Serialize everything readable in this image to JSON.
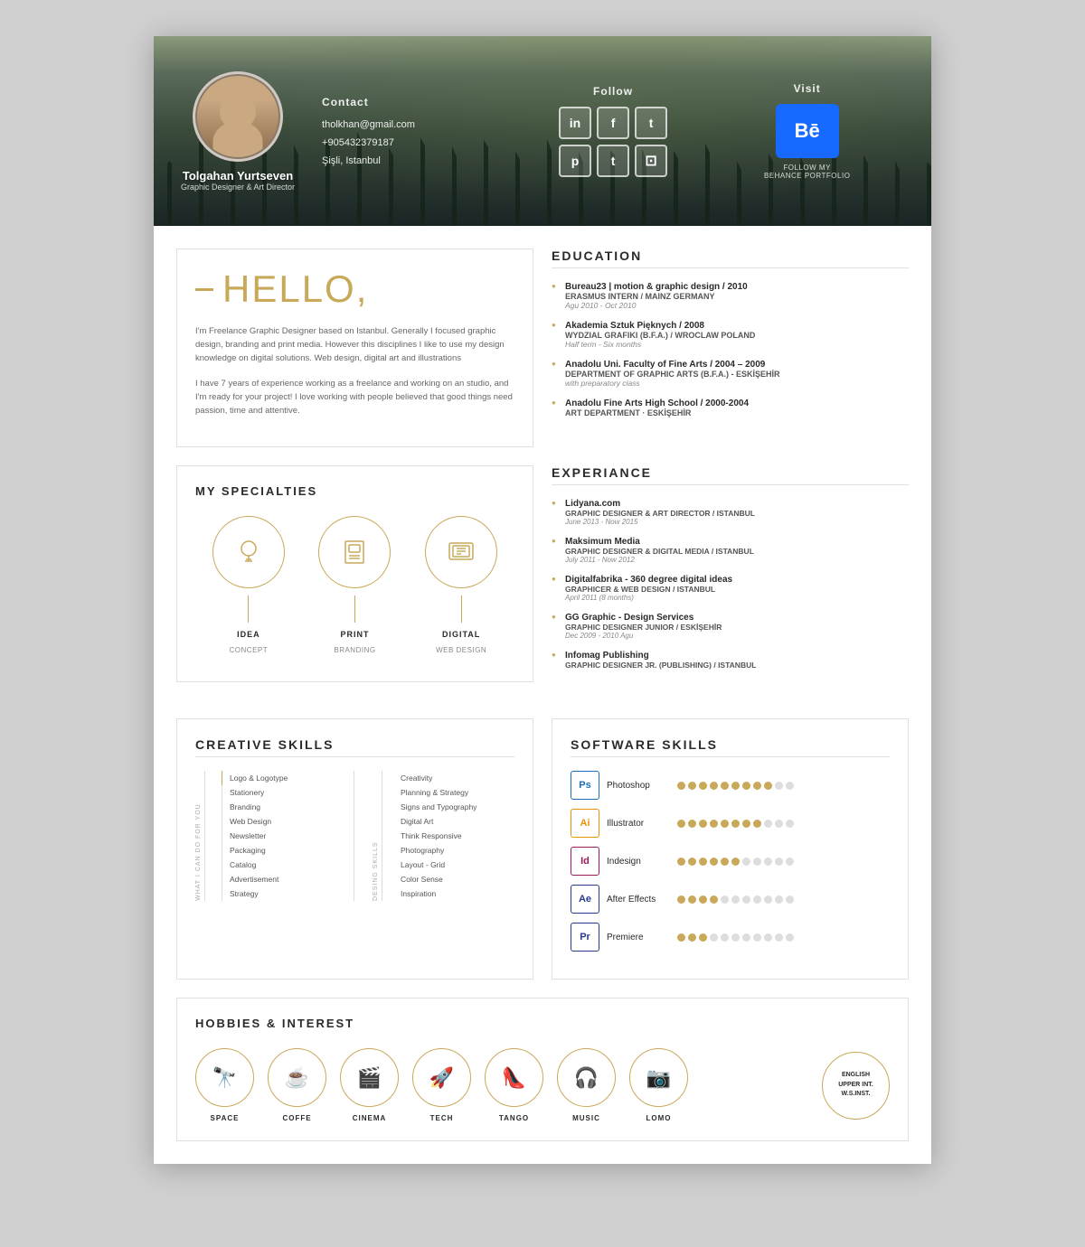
{
  "header": {
    "name": "Tolgahan Yurtseven",
    "title": "Graphic Designer & Art Director",
    "contact": {
      "label": "Contact",
      "email": "tholkhan@gmail.com",
      "phone": "+905432379187",
      "location": "Şişli, Istanbul"
    },
    "follow": {
      "label": "Follow",
      "networks": [
        "in",
        "f",
        "t",
        "p",
        "t",
        "📷"
      ]
    },
    "visit": {
      "label": "Visit",
      "behance_text": "Bē",
      "follow_text": "FOLLOW MY\nBEHANCE PORTFOLIO"
    }
  },
  "hello": {
    "heading": "HELLO,",
    "para1": "I'm Freelance Graphic Designer based on Istanbul. Generally I focused graphic design, branding and print media. However this disciplines I like to use my design knowledge on digital solutions. Web design, digital art and illustrations",
    "para2": "I have 7 years of experience working as a freelance and working on an studio, and I'm ready for your project! I love working with people believed that good things need passion, time and attentive."
  },
  "education": {
    "title": "EDUCATION",
    "items": [
      {
        "title": "Bureau23 | motion & graphic design / 2010",
        "sub": "ERASMUS INTERN / MAINZ GERMANY",
        "detail": "Agu 2010 - Oct 2010"
      },
      {
        "title": "Akademia Sztuk Pięknych / 2008",
        "sub": "WYDZIAL GRAFIKI (B.F.A.) / WROCLAW POLAND",
        "detail": "Half term - Six months"
      },
      {
        "title": "Anadolu Uni. Faculty of Fine Arts / 2004 – 2009",
        "sub": "DEPARTMENT OF GRAPHIC ARTS (B.F.A.) - ESKİŞEHİR",
        "detail": "with preparatory class"
      },
      {
        "title": "Anadolu Fine Arts High School / 2000-2004",
        "sub": "ART DEPARTMENT · ESKİŞEHİR",
        "detail": ""
      }
    ]
  },
  "specialties": {
    "title": "MY SPECIALTIES",
    "items": [
      {
        "label": "IDEA",
        "sublabel": "CONCEPT"
      },
      {
        "label": "PRINT",
        "sublabel": "BRANDING"
      },
      {
        "label": "DIGITAL",
        "sublabel": "WEB DESIGN"
      }
    ]
  },
  "experience": {
    "title": "EXPERIANCE",
    "items": [
      {
        "title": "Lidyana.com",
        "sub": "GRAPHIC DESIGNER & ART DIRECTOR / ISTANBUL",
        "date": "June 2013 - Now 2015"
      },
      {
        "title": "Maksimum Media",
        "sub": "GRAPHIC DESIGNER & DIGITAL MEDIA / ISTANBUL",
        "date": "July 2011 - Now 2012"
      },
      {
        "title": "Digitalfabrika - 360 degree digital ideas",
        "sub": "GRAPHICER & WEB DESIGN / ISTANBUL",
        "date": "April 2011 (8 months)"
      },
      {
        "title": "GG Graphic - Design Services",
        "sub": "GRAPHIC DESIGNER JUNIOR / ESKİŞEHİR",
        "date": "Dec 2009 - 2010 Agu"
      },
      {
        "title": "Infomag Publishing",
        "sub": "GRAPHIC DESIGNER JR. (PUBLISHING) / ISTANBUL",
        "date": ""
      }
    ]
  },
  "creative_skills": {
    "title": "CREATIVE SKILLS",
    "left_label": "WHAT I CAN DO FOR YOU",
    "left_items": [
      "Logo & Logotype",
      "Stationery",
      "Branding",
      "Web Design",
      "Newsletter",
      "Packaging",
      "Catalog",
      "Advertisement",
      "Strategy"
    ],
    "right_label": "DESING SKILLS",
    "right_items": [
      "Creativity",
      "Planning & Strategy",
      "Signs and Typography",
      "Digital Art",
      "Think Responsive",
      "Photography",
      "Layout - Grid",
      "Color Sense",
      "Inspiration"
    ]
  },
  "software_skills": {
    "title": "SOFTWARE SKILLS",
    "items": [
      {
        "icon": "Ps",
        "name": "Photoshop",
        "filled": 9,
        "empty": 2,
        "color": "#1a6fbf"
      },
      {
        "icon": "Ai",
        "name": "Illustrator",
        "filled": 8,
        "empty": 3,
        "color": "#e8920a"
      },
      {
        "icon": "Id",
        "name": "Indesign",
        "filled": 6,
        "empty": 5,
        "color": "#9e1a5e"
      },
      {
        "icon": "Ae",
        "name": "After Effects",
        "filled": 4,
        "empty": 7,
        "color": "#2a3b8f"
      },
      {
        "icon": "Pr",
        "name": "Premiere",
        "filled": 3,
        "empty": 8,
        "color": "#2a3b8f"
      }
    ]
  },
  "hobbies": {
    "title": "HOBBIES & INTEREST",
    "items": [
      {
        "icon": "🔭",
        "label": "SPACE"
      },
      {
        "icon": "☕",
        "label": "COFFE"
      },
      {
        "icon": "🎬",
        "label": "CINEMA"
      },
      {
        "icon": "🚀",
        "label": "TECH"
      },
      {
        "icon": "👠",
        "label": "TANGO"
      },
      {
        "icon": "🎧",
        "label": "MUSIC"
      },
      {
        "icon": "📷",
        "label": "LOMO"
      }
    ],
    "language": {
      "lines": [
        "ENGLISH",
        "UPPER INT.",
        "W.S.INST."
      ]
    }
  }
}
